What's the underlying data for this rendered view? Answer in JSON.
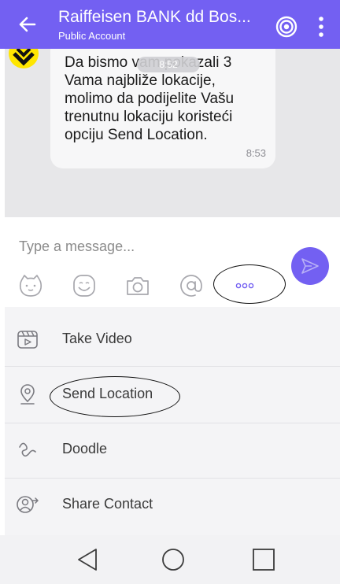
{
  "header": {
    "title": "Raiffeisen BANK dd Bos...",
    "subtitle": "Public Account",
    "back_icon": "arrow-left-icon",
    "right_icons": [
      "viber-rings-icon",
      "more-vertical-icon"
    ],
    "color": "#7360f2"
  },
  "chat": {
    "message_text": "Da bismo vam pokazali 3\nVama najbliže lokacije,\nmolimo da podijelite Vašu\ntrenutnu lokaciju koristeći\nopciju Send Location.",
    "message_time": "8:53",
    "overlay_pill": "8:52"
  },
  "composer": {
    "placeholder": "Type a message...",
    "toolbar_icons": [
      "sticker-icon",
      "emoji-icon",
      "camera-icon",
      "at-sign-icon",
      "more-horizontal-icon"
    ],
    "send_icon": "send-icon"
  },
  "menu": {
    "items": [
      {
        "label": "Take Video",
        "icon": "video-icon"
      },
      {
        "label": "Send Location",
        "icon": "location-pin-icon"
      },
      {
        "label": "Doodle",
        "icon": "doodle-icon"
      },
      {
        "label": "Share Contact",
        "icon": "share-contact-icon"
      }
    ]
  },
  "navbar": {
    "icons": [
      "nav-back-icon",
      "nav-home-icon",
      "nav-recents-icon"
    ]
  }
}
